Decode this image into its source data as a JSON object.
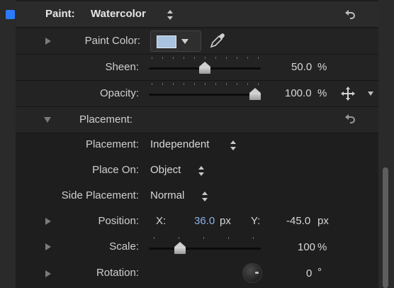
{
  "header": {
    "title": "Paint:",
    "name": "Watercolor"
  },
  "paint_color": {
    "label": "Paint Color:"
  },
  "sheen": {
    "label": "Sheen:",
    "value": "50.0",
    "unit": "%",
    "fraction": 0.5
  },
  "opacity": {
    "label": "Opacity:",
    "value": "100.0",
    "unit": "%",
    "fraction": 1.0
  },
  "placement_group": {
    "label": "Placement:"
  },
  "placement": {
    "label": "Placement:",
    "value": "Independent"
  },
  "place_on": {
    "label": "Place On:",
    "value": "Object"
  },
  "side_placement": {
    "label": "Side Placement:",
    "value": "Normal"
  },
  "position": {
    "label": "Position:",
    "x_label": "X:",
    "x_value": "36.0",
    "x_unit": "px",
    "y_label": "Y:",
    "y_value": "-45.0",
    "y_unit": "px"
  },
  "scale": {
    "label": "Scale:",
    "value": "100",
    "unit": "%",
    "fraction": 0.3
  },
  "rotation": {
    "label": "Rotation:",
    "value": "0",
    "unit": "°"
  },
  "colors": {
    "accent": "#2a7bff",
    "swatch": "#a9c3e0",
    "x_value": "#8ab0e8"
  }
}
